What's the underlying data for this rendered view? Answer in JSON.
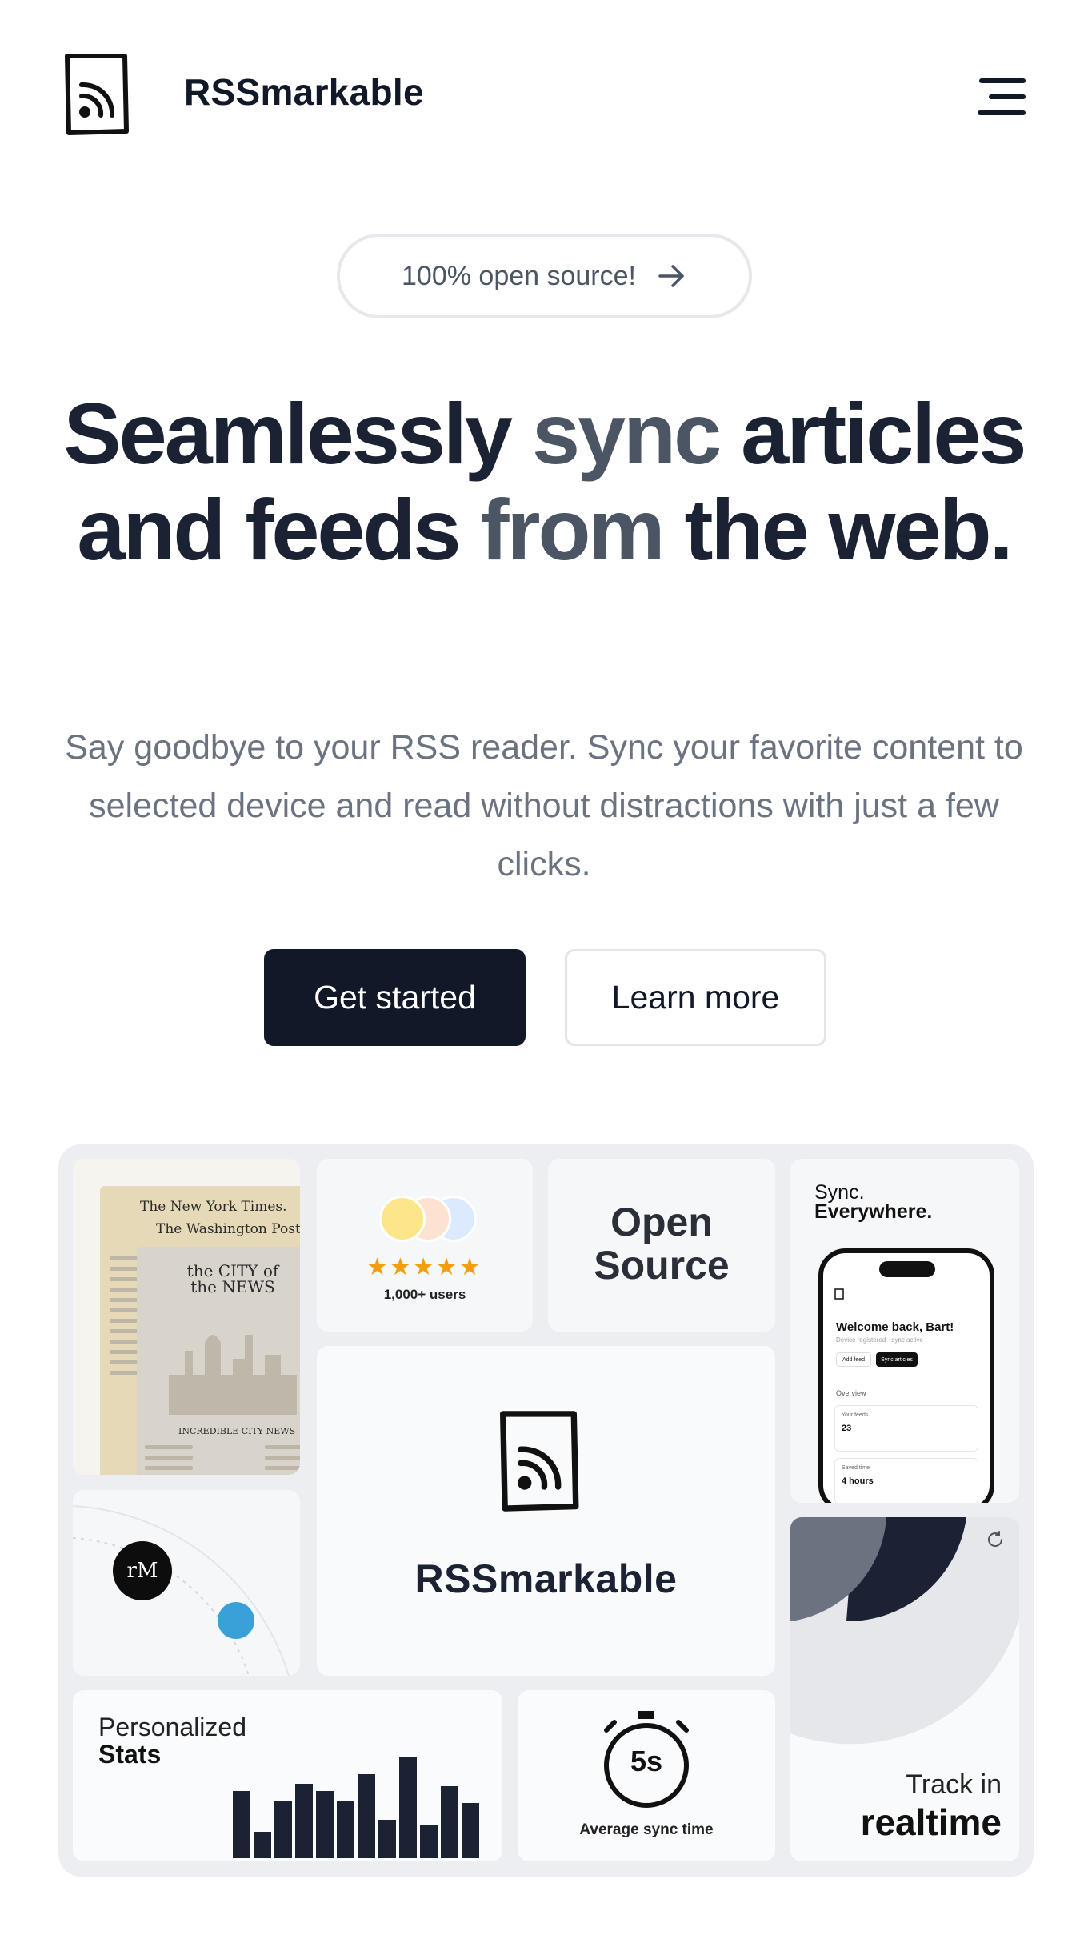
{
  "header": {
    "brand": "RSSmarkable",
    "logo_icon": "rss-notebook-icon",
    "menu_icon": "hamburger-menu-icon"
  },
  "hero": {
    "badge": "100% open source!",
    "badge_icon": "arrow-right-icon",
    "headline_part1": "Seamlessly ",
    "headline_part2": "sync",
    "headline_part3": " articles and feeds ",
    "headline_part4": "from",
    "headline_part5": " the web.",
    "subtitle": "Say goodbye to your RSS reader. Sync your favorite content to selected device and read without distractions with just a few clicks.",
    "primary_cta": "Get started",
    "secondary_cta": "Learn more"
  },
  "bento": {
    "newspaper": {
      "masthead_1": "The New York Times.",
      "masthead_2": "The Washington Post",
      "city_title": "the CITY of the NEWS",
      "city_footer": "INCREDIBLE CITY NEWS"
    },
    "users": {
      "stars": "★★★★★",
      "label": "1,000+ users"
    },
    "open_source": {
      "line1": "Open",
      "line2": "Source"
    },
    "sync": {
      "line1": "Sync.",
      "line2": "Everywhere.",
      "phone": {
        "welcome": "Welcome back, Bart!",
        "status": "Device registered · sync active",
        "add_feed": "Add feed",
        "sync_articles": "Sync articles",
        "overview": "Overview",
        "card1_label": "Your feeds",
        "card1_value": "23",
        "card2_label": "Saved time",
        "card2_value": "4 hours"
      }
    },
    "main": {
      "brand": "RSSmarkable"
    },
    "orbit": {
      "remarkable_label": "rM"
    },
    "track": {
      "line1": "Track in",
      "line2": "realtime"
    },
    "stats": {
      "line1": "Personalized",
      "line2": "Stats",
      "bars": [
        0.56,
        0.22,
        0.48,
        0.62,
        0.56,
        0.48,
        0.7,
        0.32,
        0.84,
        0.28,
        0.6,
        0.46
      ]
    },
    "timer": {
      "value": "5s",
      "label": "Average sync time"
    }
  },
  "colors": {
    "primary": "#111827",
    "text_dark": "#1b2233",
    "text_muted": "#6b7280",
    "bento_bg": "#eceef1"
  }
}
